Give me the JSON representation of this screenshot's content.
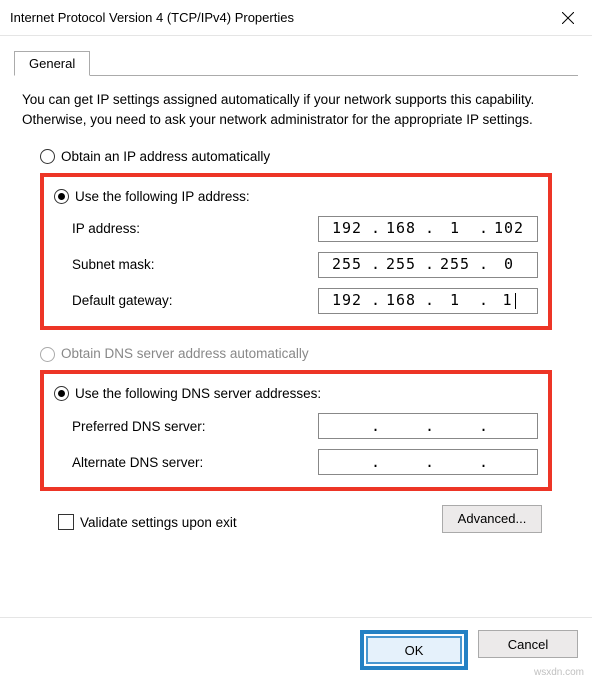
{
  "window": {
    "title": "Internet Protocol Version 4 (TCP/IPv4) Properties"
  },
  "tabs": {
    "general": "General"
  },
  "description": "You can get IP settings assigned automatically if your network supports this capability. Otherwise, you need to ask your network administrator for the appropriate IP settings.",
  "ip_section": {
    "auto_label": "Obtain an IP address automatically",
    "manual_label": "Use the following IP address:",
    "fields": {
      "ip_label": "IP address:",
      "ip": {
        "a": "192",
        "b": "168",
        "c": "1",
        "d": "102"
      },
      "mask_label": "Subnet mask:",
      "mask": {
        "a": "255",
        "b": "255",
        "c": "255",
        "d": "0"
      },
      "gw_label": "Default gateway:",
      "gw": {
        "a": "192",
        "b": "168",
        "c": "1",
        "d": "1"
      }
    }
  },
  "dns_section": {
    "auto_label": "Obtain DNS server address automatically",
    "manual_label": "Use the following DNS server addresses:",
    "fields": {
      "pref_label": "Preferred DNS server:",
      "pref": {
        "a": "",
        "b": "",
        "c": "",
        "d": ""
      },
      "alt_label": "Alternate DNS server:",
      "alt": {
        "a": "",
        "b": "",
        "c": "",
        "d": ""
      }
    }
  },
  "validate_label": "Validate settings upon exit",
  "buttons": {
    "advanced": "Advanced...",
    "ok": "OK",
    "cancel": "Cancel"
  },
  "dot": ".",
  "watermark": "wsxdn.com"
}
